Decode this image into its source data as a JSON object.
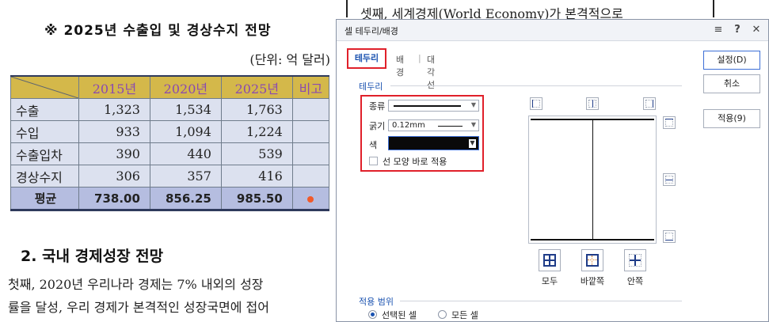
{
  "document": {
    "title": "※ 2025년 수출입 및 경상수지 전망",
    "unit": "(단위: 억 달러)",
    "table": {
      "headers": [
        "",
        "2015년",
        "2020년",
        "2025년",
        "비고"
      ],
      "rows": [
        {
          "label": "수출",
          "values": [
            "1,323",
            "1,534",
            "1,763"
          ],
          "note": ""
        },
        {
          "label": "수입",
          "values": [
            "933",
            "1,094",
            "1,224"
          ],
          "note": ""
        },
        {
          "label": "수출입차",
          "values": [
            "390",
            "440",
            "539"
          ],
          "note": ""
        },
        {
          "label": "경상수지",
          "values": [
            "306",
            "357",
            "416"
          ],
          "note": ""
        }
      ],
      "average": {
        "label": "평균",
        "values": [
          "738.00",
          "856.25",
          "985.50"
        ]
      }
    },
    "section_title": "2. 국내 경제성장 전망",
    "paragraph_line1": "첫째, 2020년 우리나라 경제는 7% 내외의 성장",
    "paragraph_line2": "률을 달성, 우리 경제가 본격적인 성장국면에 접어",
    "right_top_text": "셋째, 세계경제(World Economy)가 본격적으로"
  },
  "dialog": {
    "title": "셀 테두리/배경",
    "titlebar_icons": [
      "list-icon",
      "help-icon",
      "close-icon"
    ],
    "tabs": [
      {
        "label": "테두리",
        "active": true
      },
      {
        "label": "배경",
        "active": false
      },
      {
        "label": "대각선",
        "active": false
      }
    ],
    "border_group": {
      "label": "테두리",
      "type_label": "종류",
      "width_label": "굵기",
      "width_value": "0.12mm",
      "color_label": "색",
      "color_value": "#000000",
      "apply_immediately_label": "선 모양 바로 적용",
      "apply_immediately_checked": false
    },
    "preview_buttons": {
      "all_label": "모두",
      "outer_label": "바깥쪽",
      "inner_label": "안쪽"
    },
    "scope_group": {
      "label": "적용 범위",
      "options": [
        {
          "label": "선택된 셀",
          "selected": true
        },
        {
          "label": "모든 셀",
          "selected": false
        }
      ]
    },
    "buttons": {
      "ok": "설정(D)",
      "cancel": "취소",
      "apply": "적용(9)"
    }
  }
}
